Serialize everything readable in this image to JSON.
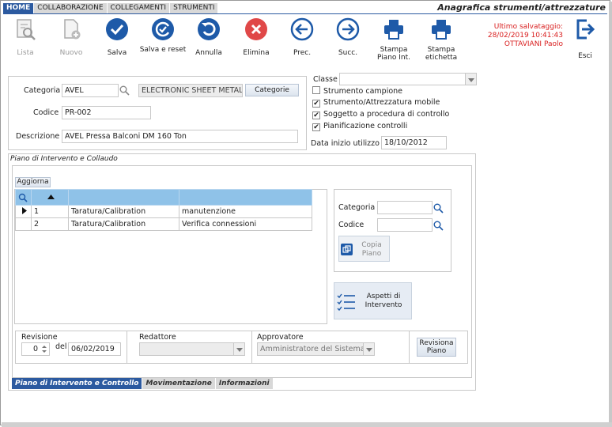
{
  "window_title": "Anagrafica strumenti/attrezzature",
  "top_tabs": [
    "HOME",
    "COLLABORAZIONE",
    "COLLEGAMENTI",
    "STRUMENTI"
  ],
  "toolbar": {
    "lista": "Lista",
    "nuovo": "Nuovo",
    "salva": "Salva",
    "salva_reset": "Salva e reset",
    "annulla": "Annulla",
    "elimina": "Elimina",
    "prec": "Prec.",
    "succ": "Succ.",
    "stampa_piano": "Stampa Piano Int.",
    "stampa_etichetta": "Stampa etichetta",
    "esci": "Esci"
  },
  "save_info": {
    "label": "Ultimo salvataggio:",
    "timestamp": "28/02/2019 10:41:43",
    "user": "OTTAVIANI Paolo"
  },
  "form": {
    "categoria_label": "Categoria",
    "categoria_value": "AVEL",
    "categoria_desc": "ELECTRONIC SHEET METAL P",
    "categorie_button": "Categorie",
    "codice_label": "Codice",
    "codice_value": "PR-002",
    "descrizione_label": "Descrizione",
    "descrizione_value": "AVEL Pressa Balconi DM 160 Ton",
    "classe_label": "Classe",
    "classe_value": "",
    "strumento_campione": "Strumento campione",
    "strumento_mobile": "Strumento/Attrezzatura mobile",
    "soggetto_procedura": "Soggetto a procedura di controllo",
    "pianificazione": "Pianificazione controlli",
    "data_inizio_label": "Data inizio utilizzo",
    "data_inizio_value": "18/10/2012"
  },
  "checks": {
    "strumento_campione": false,
    "strumento_mobile": true,
    "soggetto_procedura": true,
    "pianificazione": true
  },
  "piano": {
    "title": "Piano di Intervento e Collaudo",
    "aggiorna": "Aggiorna",
    "rows": [
      {
        "num": "1",
        "tipo": "Taratura/Calibration",
        "desc": "manutenzione"
      },
      {
        "num": "2",
        "tipo": "Taratura/Calibration",
        "desc": "Verifica connessioni"
      }
    ],
    "side_categoria_label": "Categoria",
    "side_codice_label": "Codice",
    "copia_piano": "Copia Piano",
    "aspetti": "Aspetti di Intervento"
  },
  "revisione": {
    "revisione_label": "Revisione",
    "revisione_value": "0",
    "del_label": "del",
    "del_value": "06/02/2019",
    "redattore_label": "Redattore",
    "redattore_value": "",
    "approvatore_label": "Approvatore",
    "approvatore_value": "Amministratore del Sistema",
    "revisiona_button": "Revisiona Piano"
  },
  "bottom_tabs": [
    "Piano di Intervento e Controllo",
    "Movimentazione",
    "Informazioni"
  ],
  "colors": {
    "accent": "#2c5aa0",
    "icon_blue": "#1e5aa8",
    "delete_red": "#e04848",
    "save_info_red": "#d92020",
    "grid_header": "#8fc2e8"
  }
}
